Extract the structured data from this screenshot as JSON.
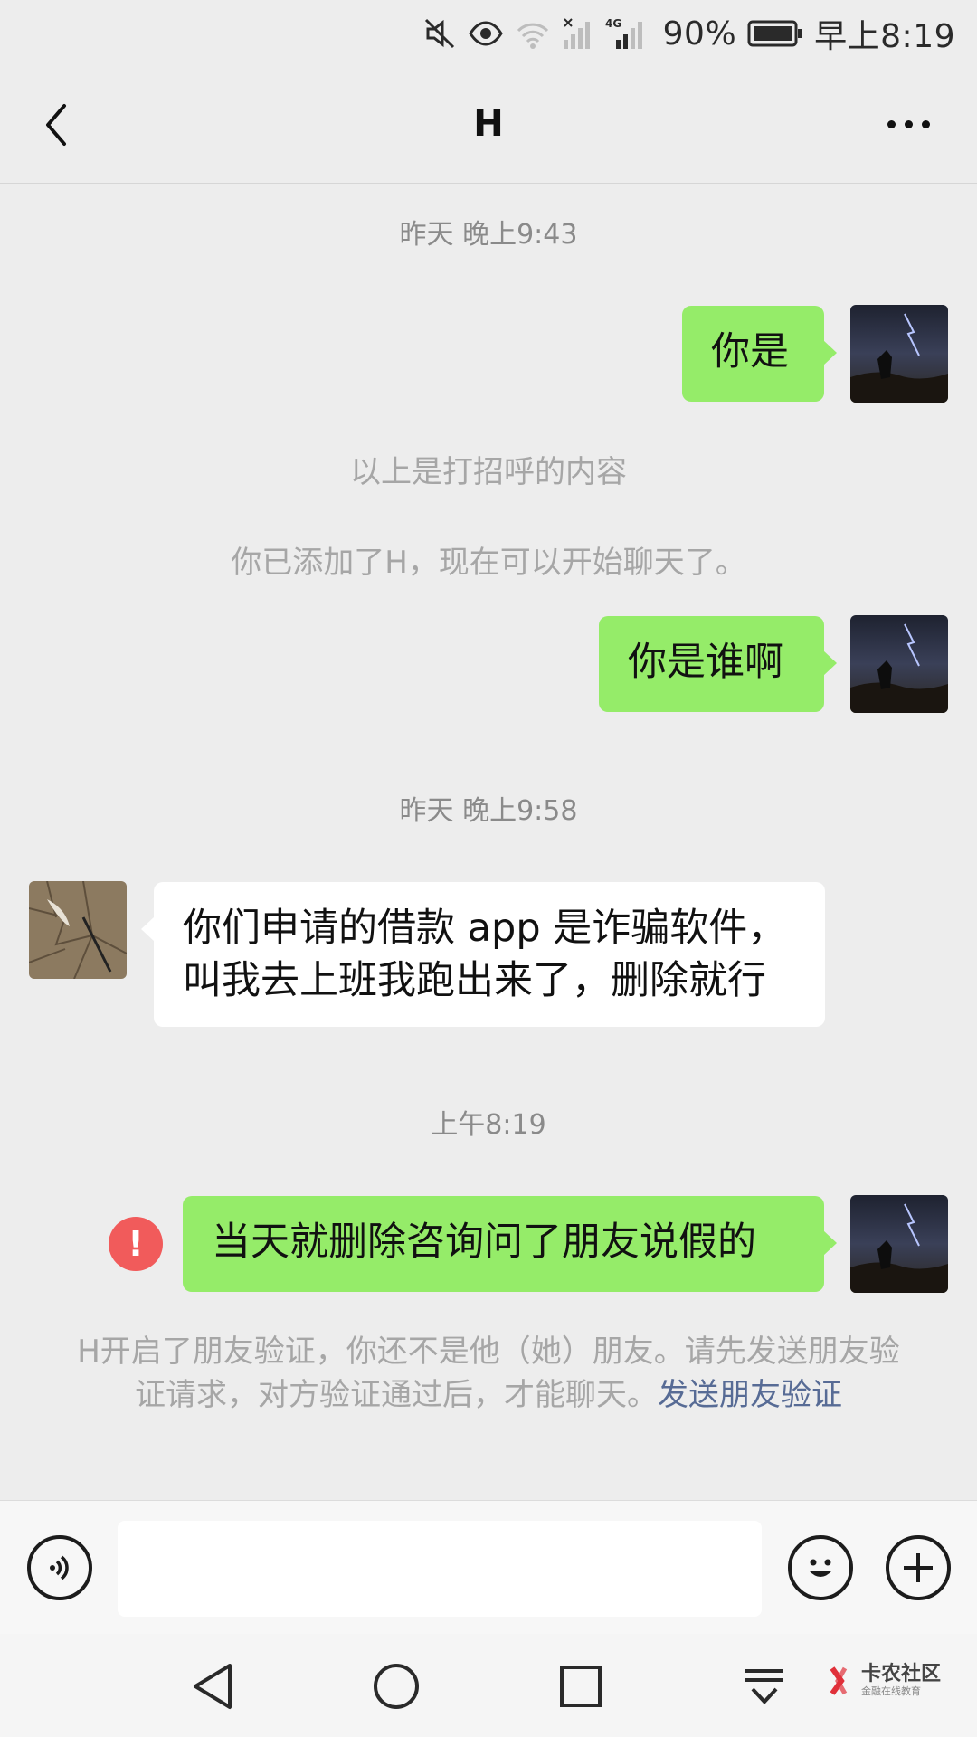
{
  "status_bar": {
    "battery": "90%",
    "time": "早上8:19"
  },
  "header": {
    "title": "H"
  },
  "messages": [
    {
      "kind": "timestamp",
      "text": "昨天 晚上9:43"
    },
    {
      "kind": "sent",
      "text": "你是"
    },
    {
      "kind": "system",
      "text": "以上是打招呼的内容"
    },
    {
      "kind": "system",
      "text": "你已添加了H，现在可以开始聊天了。"
    },
    {
      "kind": "sent",
      "text": "你是谁啊"
    },
    {
      "kind": "timestamp",
      "text": "昨天 晚上9:58"
    },
    {
      "kind": "received",
      "line1": "你们申请的借款 app 是诈骗软件，",
      "line2": "叫我去上班我跑出来了，删除就行"
    },
    {
      "kind": "timestamp",
      "text": "上午8:19"
    },
    {
      "kind": "sent_failed",
      "text": "当天就删除咨询问了朋友说假的",
      "status_icon": "!"
    }
  ],
  "notice": {
    "text": "H开启了朋友验证，你还不是他（她）朋友。请先发送朋友验证请求，对方验证通过后，才能聊天。",
    "link": "发送朋友验证"
  },
  "input_bar": {
    "placeholder": ""
  },
  "watermark": {
    "title": "卡农社区",
    "subtitle": "金融在线教育"
  },
  "colors": {
    "sent_bubble": "#95ec69",
    "received_bubble": "#ffffff",
    "background": "#ededed",
    "link": "#576b95",
    "error": "#f15b5b"
  },
  "icons": [
    "mute-icon",
    "eye-icon",
    "wifi-icon",
    "signal-icon",
    "battery-icon",
    "back-icon",
    "more-icon",
    "voice-icon",
    "emoji-icon",
    "plus-icon",
    "nav-back-icon",
    "nav-home-icon",
    "nav-recents-icon",
    "nav-menu-icon"
  ]
}
